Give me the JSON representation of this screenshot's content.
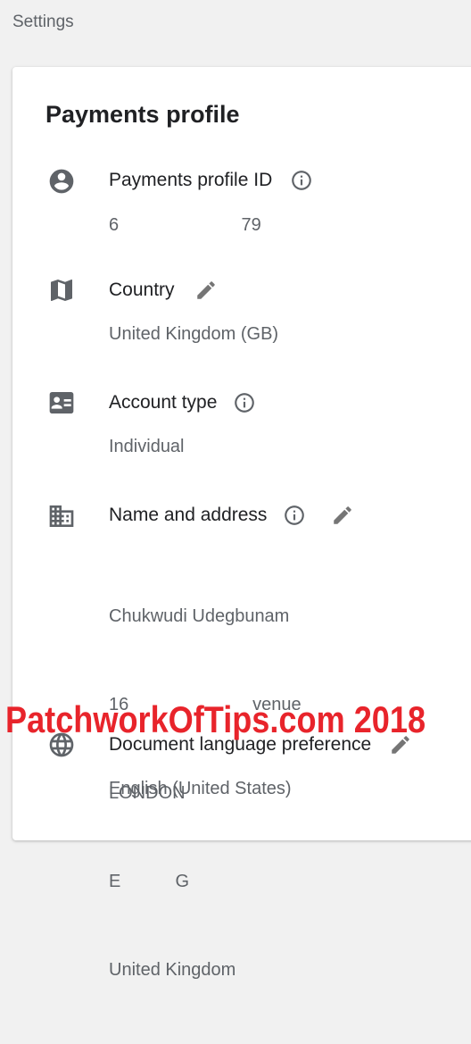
{
  "page": {
    "title": "Settings"
  },
  "card": {
    "title": "Payments profile"
  },
  "sections": {
    "profile_id": {
      "title": "Payments profile ID",
      "value": "6                         79",
      "icon": "account-circle-icon"
    },
    "country": {
      "title": "Country",
      "value": "United Kingdom (GB)",
      "icon": "map-icon"
    },
    "account_type": {
      "title": "Account type",
      "value": "Individual",
      "icon": "account-box-icon"
    },
    "name_address": {
      "title": "Name and address",
      "lines": [
        "Chukwudi Udegbunam",
        "16                         venue",
        "LONDON",
        "E           G",
        "United Kingdom"
      ],
      "icon": "business-icon"
    },
    "doc_language": {
      "title": "Document language preference",
      "value": "English (United States)",
      "icon": "globe-icon"
    }
  },
  "watermark": {
    "text": "PatchworkOfTips.com 2018"
  },
  "colors": {
    "accent_icon": "#5f6368",
    "watermark": "#e8242b"
  }
}
